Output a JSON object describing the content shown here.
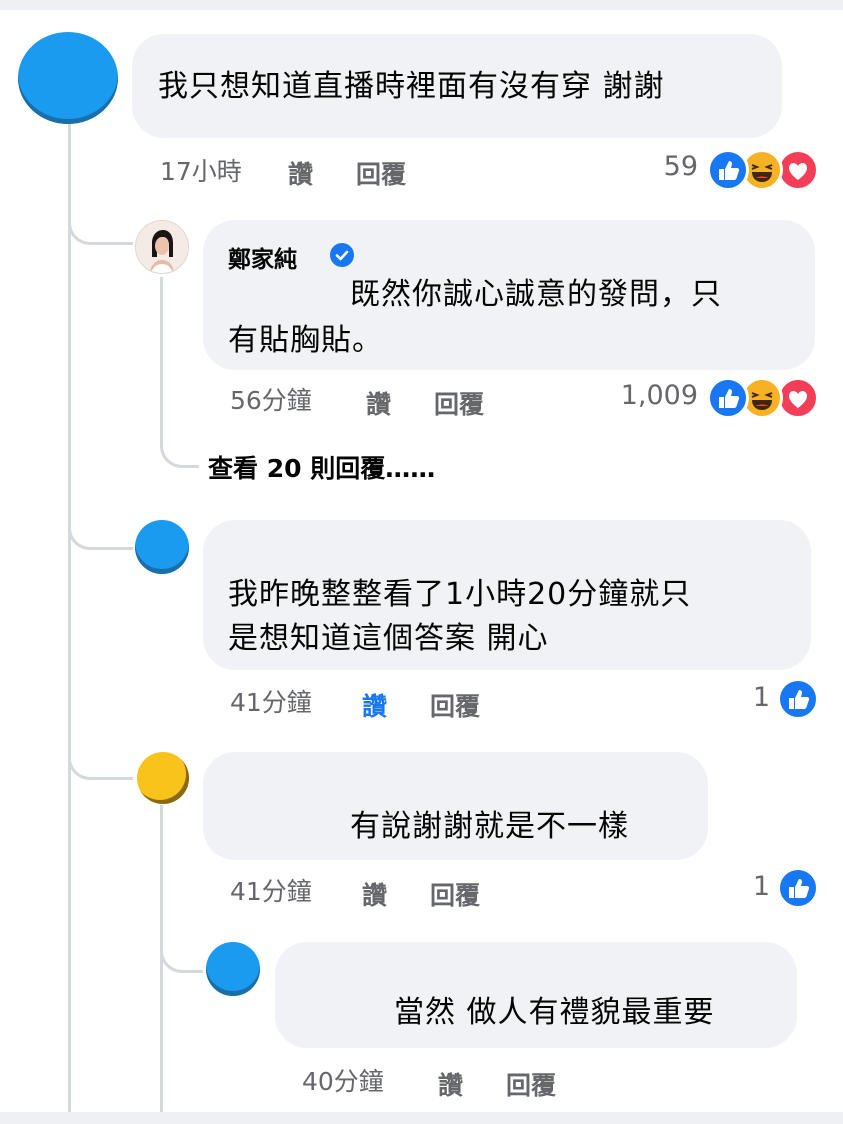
{
  "comments": [
    {
      "text": "我只想知道直播時裡面有沒有穿 謝謝",
      "time": "17小時",
      "like_label": "讚",
      "reply_label": "回覆",
      "reaction_count": "59",
      "reactions": [
        "like-icon",
        "haha-icon",
        "love-icon"
      ]
    },
    {
      "author": "鄭家純",
      "verified": true,
      "text_line1": "既然你誠心誠意的發問，只",
      "text_line2": "有貼胸貼。",
      "time": "56分鐘",
      "like_label": "讚",
      "reply_label": "回覆",
      "reaction_count": "1,009",
      "reactions": [
        "like-icon",
        "haha-icon",
        "love-icon"
      ]
    },
    {
      "text_line1": "我昨晚整整看了1小時20分鐘就只",
      "text_line2": "是想知道這個答案 開心",
      "time": "41分鐘",
      "like_label": "讚",
      "like_active": true,
      "reply_label": "回覆",
      "reaction_count": "1",
      "reactions": [
        "like-icon"
      ]
    },
    {
      "text": "有說謝謝就是不一樣",
      "time": "41分鐘",
      "like_label": "讚",
      "reply_label": "回覆",
      "reaction_count": "1",
      "reactions": [
        "like-icon"
      ]
    },
    {
      "text": "當然 做人有禮貌最重要",
      "time": "40分鐘",
      "like_label": "讚",
      "reply_label": "回覆"
    }
  ],
  "view_more_replies": "查看 20 則回覆……",
  "colors": {
    "like_blue": "#1877f2",
    "bubble_bg": "#f0f2f5",
    "meta_gray": "#65676b",
    "love_red": "#f33e58",
    "haha_yellow": "#f7b125"
  }
}
